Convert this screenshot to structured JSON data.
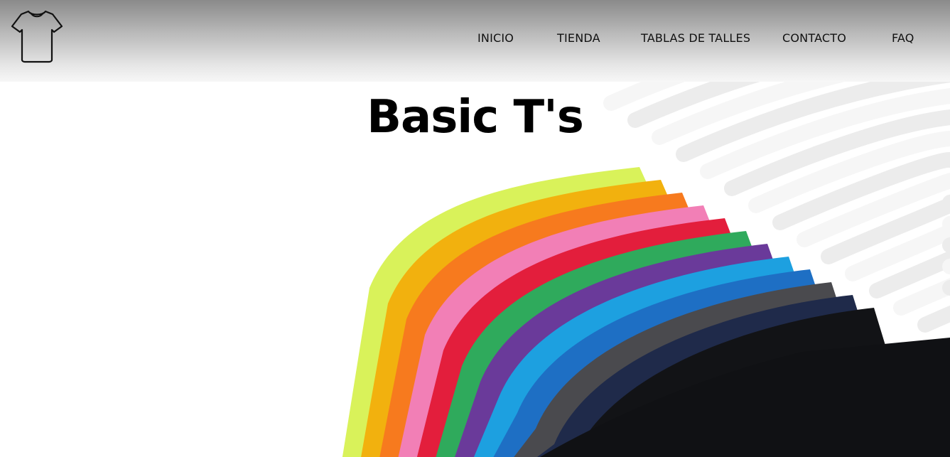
{
  "header": {
    "logo_icon": "t-shirt-icon",
    "background_top": "#8a8a8a",
    "background_bottom": "#f7f7f7"
  },
  "nav": {
    "items": [
      {
        "label": "INICIO"
      },
      {
        "label": "TIENDA"
      },
      {
        "label": "TABLAS DE TALLES"
      },
      {
        "label": "CONTACTO"
      },
      {
        "label": "FAQ"
      }
    ]
  },
  "hero": {
    "title": "Basic T's",
    "image": "colorful-t-shirts-on-hangers",
    "shirt_colors": [
      "#d9f25a",
      "#f2b10e",
      "#f77a1e",
      "#f27fb6",
      "#e31e3c",
      "#2faa5c",
      "#6a3a9a",
      "#1da0e0",
      "#1e6fc4",
      "#4a4a4e",
      "#1f2a4a",
      "#121316"
    ]
  }
}
